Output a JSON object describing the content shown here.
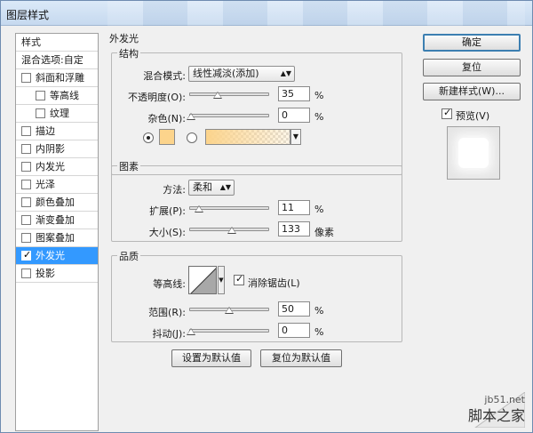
{
  "window": {
    "title": "图层样式"
  },
  "styles": {
    "header": "样式",
    "blend_options": "混合选项:自定",
    "items": [
      {
        "label": "斜面和浮雕",
        "checked": false,
        "indent": false
      },
      {
        "label": "等高线",
        "checked": false,
        "indent": true
      },
      {
        "label": "纹理",
        "checked": false,
        "indent": true
      },
      {
        "label": "描边",
        "checked": false,
        "indent": false
      },
      {
        "label": "内阴影",
        "checked": false,
        "indent": false
      },
      {
        "label": "内发光",
        "checked": false,
        "indent": false
      },
      {
        "label": "光泽",
        "checked": false,
        "indent": false
      },
      {
        "label": "颜色叠加",
        "checked": false,
        "indent": false
      },
      {
        "label": "渐变叠加",
        "checked": false,
        "indent": false
      },
      {
        "label": "图案叠加",
        "checked": false,
        "indent": false
      },
      {
        "label": "外发光",
        "checked": true,
        "indent": false,
        "selected": true
      },
      {
        "label": "投影",
        "checked": false,
        "indent": false
      }
    ]
  },
  "outer_glow": {
    "title": "外发光",
    "structure": {
      "title": "结构",
      "blend_mode_label": "混合模式:",
      "blend_mode_value": "线性减淡(添加)",
      "opacity_label": "不透明度(O):",
      "opacity_value": "35",
      "opacity_unit": "%",
      "opacity_fraction": 0.35,
      "noise_label": "杂色(N):",
      "noise_value": "0",
      "noise_unit": "%",
      "noise_fraction": 0,
      "color": "#fcd48c"
    },
    "elements": {
      "title": "图素",
      "method_label": "方法:",
      "method_value": "柔和",
      "spread_label": "扩展(P):",
      "spread_value": "11",
      "spread_unit": "%",
      "spread_fraction": 0.11,
      "size_label": "大小(S):",
      "size_value": "133",
      "size_unit": "像素",
      "size_fraction": 0.53
    },
    "quality": {
      "title": "品质",
      "contour_label": "等高线:",
      "antialias_label": "消除锯齿(L)",
      "antialias_checked": true,
      "range_label": "范围(R):",
      "range_value": "50",
      "range_unit": "%",
      "range_fraction": 0.5,
      "jitter_label": "抖动(J):",
      "jitter_value": "0",
      "jitter_unit": "%",
      "jitter_fraction": 0
    },
    "make_default": "设置为默认值",
    "reset_default": "复位为默认值"
  },
  "buttons": {
    "ok": "确定",
    "reset": "复位",
    "new_style": "新建样式(W)...",
    "preview_label": "预览(V)",
    "preview_checked": true
  },
  "watermark": {
    "site": "jb51.net",
    "name": "脚本之家"
  }
}
